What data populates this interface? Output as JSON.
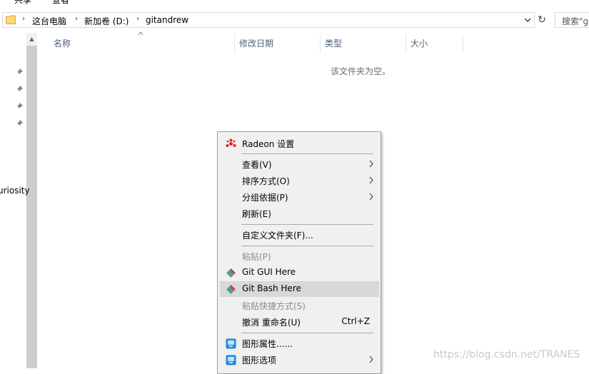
{
  "ribbon": {
    "tab_left": "共享",
    "tab_right": "查看"
  },
  "address": {
    "crumbs": [
      "这台电脑",
      "新加卷 (D:)",
      "gitandrew"
    ],
    "search_placeholder": "搜索\"gi"
  },
  "nav": {
    "partial_item": "uriosity"
  },
  "columns": {
    "name": "名称",
    "modified": "修改日期",
    "type": "类型",
    "size": "大小"
  },
  "empty_message": "该文件夹为空。",
  "context_menu": {
    "radeon": "Radeon 设置",
    "view": "查看(V)",
    "sort": "排序方式(O)",
    "group": "分组依据(P)",
    "refresh": "刷新(E)",
    "customize": "自定义文件夹(F)...",
    "paste": "粘贴(P)",
    "git_gui": "Git GUI Here",
    "git_bash": "Git Bash Here",
    "paste_shortcut": "粘贴快捷方式(S)",
    "undo_rename": "撤消 重命名(U)",
    "undo_shortcut": "Ctrl+Z",
    "graphics_props": "图形属性......",
    "graphics_options": "图形选项"
  },
  "watermark": "https://blog.csdn.net/TRANES",
  "colors": {
    "radeon_red": "#e0262a",
    "highlight": "#d8d8d8",
    "column_text": "#4c607a"
  }
}
